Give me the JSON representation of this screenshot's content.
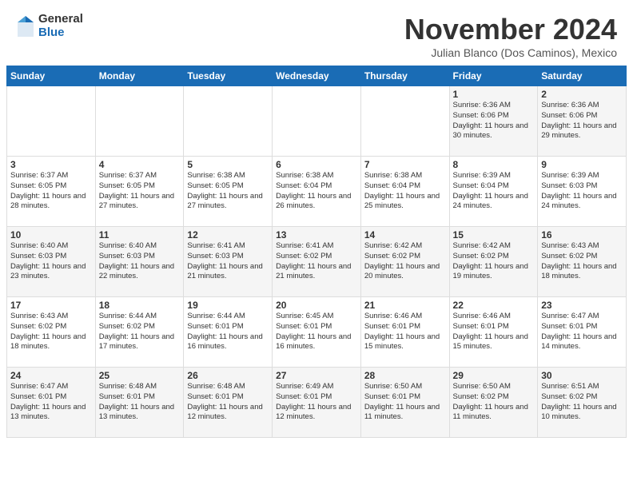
{
  "header": {
    "logo_general": "General",
    "logo_blue": "Blue",
    "month_title": "November 2024",
    "location": "Julian Blanco (Dos Caminos), Mexico"
  },
  "days_of_week": [
    "Sunday",
    "Monday",
    "Tuesday",
    "Wednesday",
    "Thursday",
    "Friday",
    "Saturday"
  ],
  "weeks": [
    [
      {
        "num": "",
        "detail": ""
      },
      {
        "num": "",
        "detail": ""
      },
      {
        "num": "",
        "detail": ""
      },
      {
        "num": "",
        "detail": ""
      },
      {
        "num": "",
        "detail": ""
      },
      {
        "num": "1",
        "detail": "Sunrise: 6:36 AM\nSunset: 6:06 PM\nDaylight: 11 hours and 30 minutes."
      },
      {
        "num": "2",
        "detail": "Sunrise: 6:36 AM\nSunset: 6:06 PM\nDaylight: 11 hours and 29 minutes."
      }
    ],
    [
      {
        "num": "3",
        "detail": "Sunrise: 6:37 AM\nSunset: 6:05 PM\nDaylight: 11 hours and 28 minutes."
      },
      {
        "num": "4",
        "detail": "Sunrise: 6:37 AM\nSunset: 6:05 PM\nDaylight: 11 hours and 27 minutes."
      },
      {
        "num": "5",
        "detail": "Sunrise: 6:38 AM\nSunset: 6:05 PM\nDaylight: 11 hours and 27 minutes."
      },
      {
        "num": "6",
        "detail": "Sunrise: 6:38 AM\nSunset: 6:04 PM\nDaylight: 11 hours and 26 minutes."
      },
      {
        "num": "7",
        "detail": "Sunrise: 6:38 AM\nSunset: 6:04 PM\nDaylight: 11 hours and 25 minutes."
      },
      {
        "num": "8",
        "detail": "Sunrise: 6:39 AM\nSunset: 6:04 PM\nDaylight: 11 hours and 24 minutes."
      },
      {
        "num": "9",
        "detail": "Sunrise: 6:39 AM\nSunset: 6:03 PM\nDaylight: 11 hours and 24 minutes."
      }
    ],
    [
      {
        "num": "10",
        "detail": "Sunrise: 6:40 AM\nSunset: 6:03 PM\nDaylight: 11 hours and 23 minutes."
      },
      {
        "num": "11",
        "detail": "Sunrise: 6:40 AM\nSunset: 6:03 PM\nDaylight: 11 hours and 22 minutes."
      },
      {
        "num": "12",
        "detail": "Sunrise: 6:41 AM\nSunset: 6:03 PM\nDaylight: 11 hours and 21 minutes."
      },
      {
        "num": "13",
        "detail": "Sunrise: 6:41 AM\nSunset: 6:02 PM\nDaylight: 11 hours and 21 minutes."
      },
      {
        "num": "14",
        "detail": "Sunrise: 6:42 AM\nSunset: 6:02 PM\nDaylight: 11 hours and 20 minutes."
      },
      {
        "num": "15",
        "detail": "Sunrise: 6:42 AM\nSunset: 6:02 PM\nDaylight: 11 hours and 19 minutes."
      },
      {
        "num": "16",
        "detail": "Sunrise: 6:43 AM\nSunset: 6:02 PM\nDaylight: 11 hours and 18 minutes."
      }
    ],
    [
      {
        "num": "17",
        "detail": "Sunrise: 6:43 AM\nSunset: 6:02 PM\nDaylight: 11 hours and 18 minutes."
      },
      {
        "num": "18",
        "detail": "Sunrise: 6:44 AM\nSunset: 6:02 PM\nDaylight: 11 hours and 17 minutes."
      },
      {
        "num": "19",
        "detail": "Sunrise: 6:44 AM\nSunset: 6:01 PM\nDaylight: 11 hours and 16 minutes."
      },
      {
        "num": "20",
        "detail": "Sunrise: 6:45 AM\nSunset: 6:01 PM\nDaylight: 11 hours and 16 minutes."
      },
      {
        "num": "21",
        "detail": "Sunrise: 6:46 AM\nSunset: 6:01 PM\nDaylight: 11 hours and 15 minutes."
      },
      {
        "num": "22",
        "detail": "Sunrise: 6:46 AM\nSunset: 6:01 PM\nDaylight: 11 hours and 15 minutes."
      },
      {
        "num": "23",
        "detail": "Sunrise: 6:47 AM\nSunset: 6:01 PM\nDaylight: 11 hours and 14 minutes."
      }
    ],
    [
      {
        "num": "24",
        "detail": "Sunrise: 6:47 AM\nSunset: 6:01 PM\nDaylight: 11 hours and 13 minutes."
      },
      {
        "num": "25",
        "detail": "Sunrise: 6:48 AM\nSunset: 6:01 PM\nDaylight: 11 hours and 13 minutes."
      },
      {
        "num": "26",
        "detail": "Sunrise: 6:48 AM\nSunset: 6:01 PM\nDaylight: 11 hours and 12 minutes."
      },
      {
        "num": "27",
        "detail": "Sunrise: 6:49 AM\nSunset: 6:01 PM\nDaylight: 11 hours and 12 minutes."
      },
      {
        "num": "28",
        "detail": "Sunrise: 6:50 AM\nSunset: 6:01 PM\nDaylight: 11 hours and 11 minutes."
      },
      {
        "num": "29",
        "detail": "Sunrise: 6:50 AM\nSunset: 6:02 PM\nDaylight: 11 hours and 11 minutes."
      },
      {
        "num": "30",
        "detail": "Sunrise: 6:51 AM\nSunset: 6:02 PM\nDaylight: 11 hours and 10 minutes."
      }
    ]
  ]
}
